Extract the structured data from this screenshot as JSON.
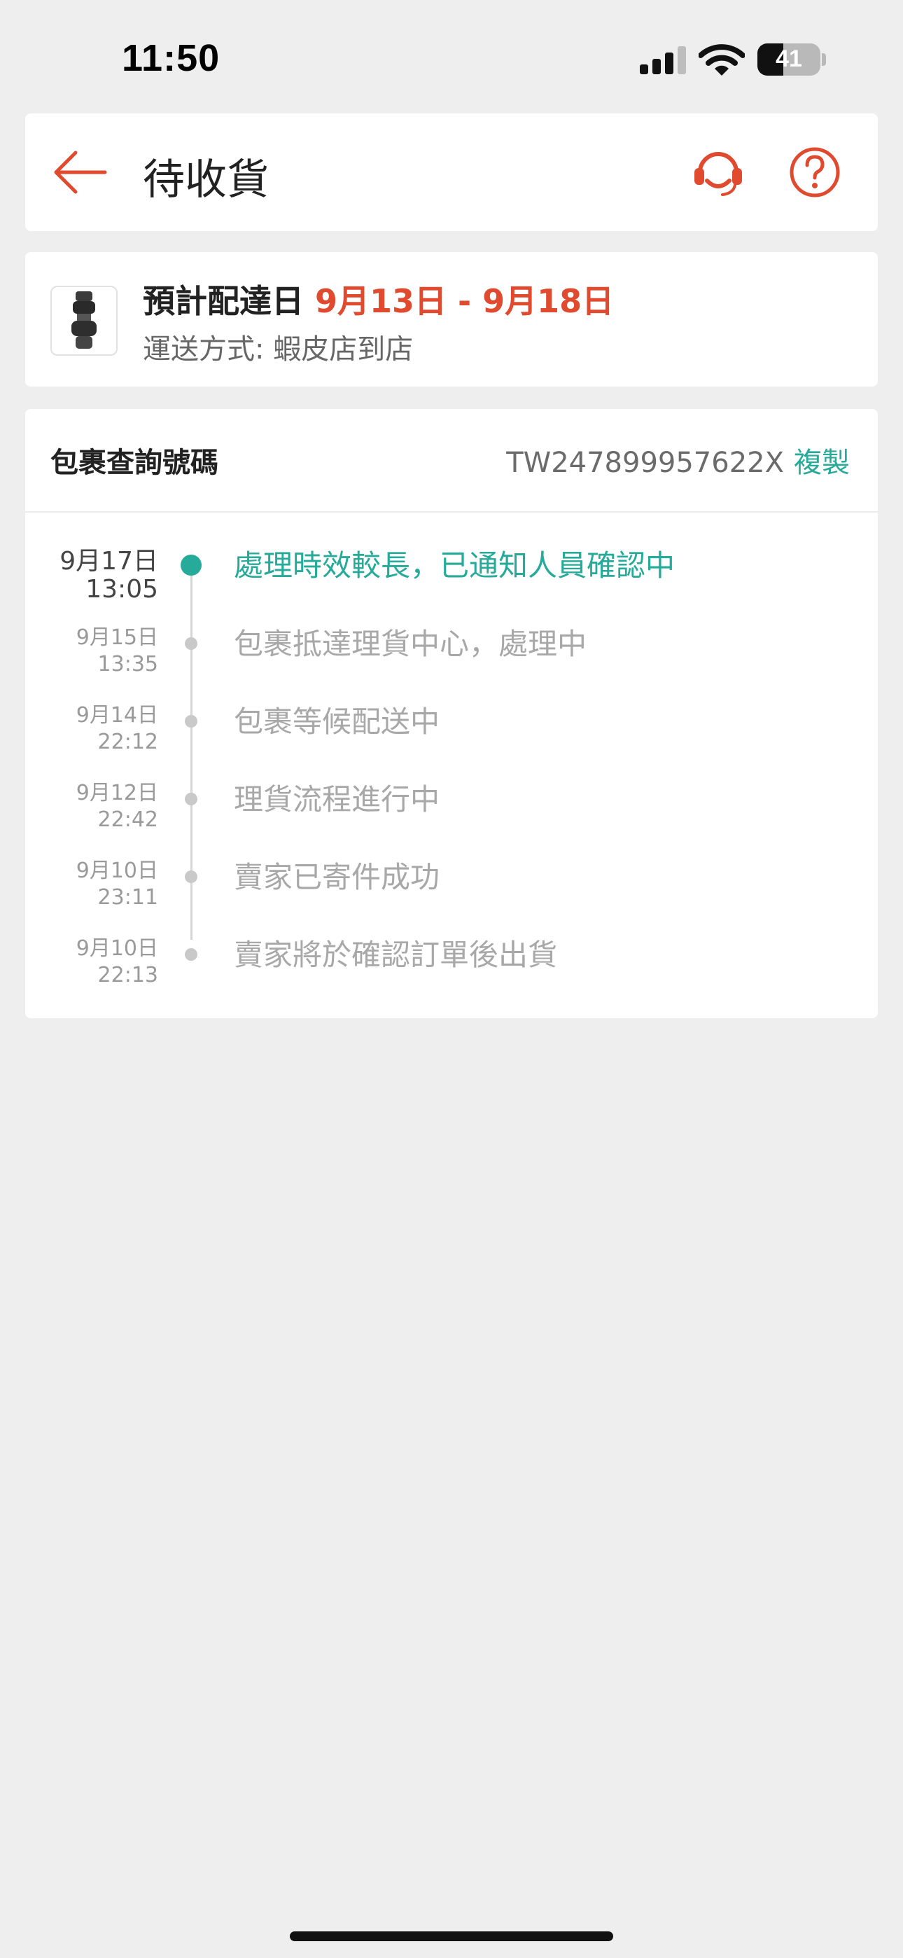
{
  "status_bar": {
    "time": "11:50",
    "battery": "41",
    "battery_level": 0.41
  },
  "header": {
    "title": "待收貨"
  },
  "delivery": {
    "eta_label": "預計配達日",
    "eta_range": "9月13日 - 9月18日",
    "shipping_method": "運送方式: 蝦皮店到店"
  },
  "tracking": {
    "label": "包裹查詢號碼",
    "number": "TW247899957622X",
    "copy_label": "複製"
  },
  "events": [
    {
      "date": "9月17日",
      "time": "13:05",
      "text": "處理時效較長，已通知人員確認中"
    },
    {
      "date": "9月15日",
      "time": "13:35",
      "text": "包裹抵達理貨中心，處理中"
    },
    {
      "date": "9月14日",
      "time": "22:12",
      "text": "包裹等候配送中"
    },
    {
      "date": "9月12日",
      "time": "22:42",
      "text": "理貨流程進行中"
    },
    {
      "date": "9月10日",
      "time": "23:11",
      "text": "賣家已寄件成功"
    },
    {
      "date": "9月10日",
      "time": "22:13",
      "text": "賣家將於確認訂單後出貨"
    }
  ],
  "colors": {
    "accent": "#e04a2f",
    "teal": "#26aa99",
    "background": "#eeeeee"
  },
  "icons": [
    "back-arrow-icon",
    "customer-service-icon",
    "help-icon",
    "signal-icon",
    "wifi-icon",
    "battery-icon"
  ]
}
